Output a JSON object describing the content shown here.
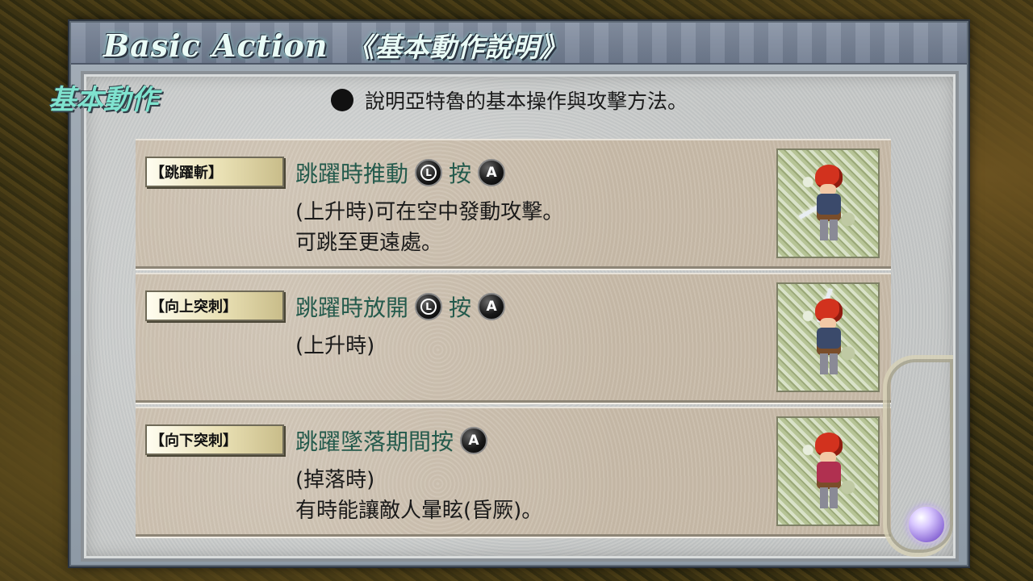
{
  "header": {
    "title": "Basic Action",
    "subtitle": "《基本動作說明》"
  },
  "section": {
    "title": "基本動作",
    "description": "說明亞特魯的基本操作與攻擊方法。"
  },
  "buttons": {
    "l_stick": "L",
    "a": "A"
  },
  "actions": [
    {
      "tag": "【跳躍斬】",
      "command_a": "跳躍時推動",
      "command_b": "按",
      "line2": "(上升時)可在空中發動攻擊。",
      "line3": "可跳至更遠處。",
      "thumb_icon": "adol-jump-slash"
    },
    {
      "tag": "【向上突刺】",
      "command_a": "跳躍時放開",
      "command_b": "按",
      "line2": "(上升時)",
      "line3": "",
      "thumb_icon": "adol-upward-thrust"
    },
    {
      "tag": "【向下突刺】",
      "command_a": "跳躍墜落期間按",
      "line2": "(掉落時)",
      "line3": "有時能讓敵人暈眩(昏厥)。",
      "thumb_icon": "adol-downward-thrust"
    }
  ],
  "colors": {
    "title_text": "#e9fbf6",
    "section_title": "#7fe3cf",
    "command_text": "#245a4c",
    "body_text": "#1a1a1a"
  }
}
